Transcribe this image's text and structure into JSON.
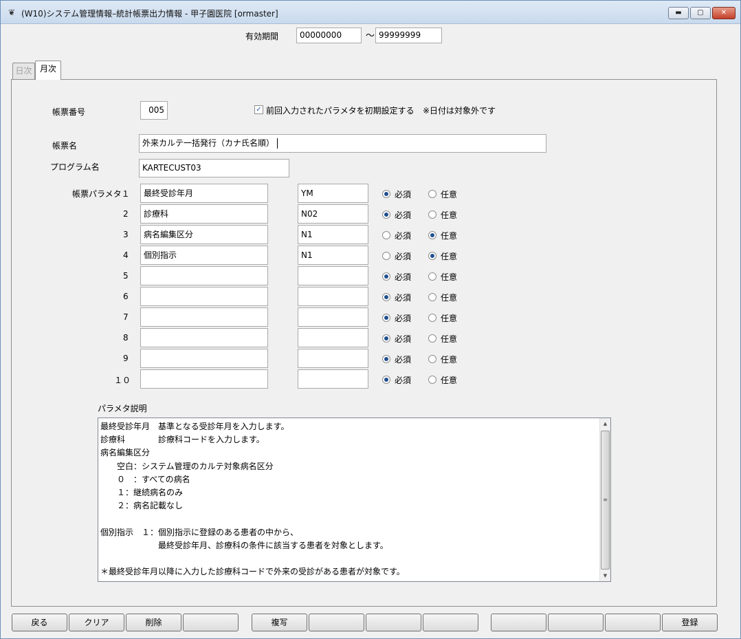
{
  "window": {
    "title": "(W10)システム管理情報–統計帳票出力情報 - 甲子園医院  [ormaster]",
    "minimize": "▬",
    "maximize": "▢",
    "close": "✕"
  },
  "period": {
    "label": "有効期間",
    "start": "00000000",
    "separator": "～",
    "end": "99999999"
  },
  "tabs": {
    "daily": "日次",
    "monthly": "月次"
  },
  "form": {
    "report_no_label": "帳票番号",
    "report_no": "005",
    "init_check_label": "前回入力されたパラメタを初期設定する",
    "init_check_note": "※日付は対象外です",
    "report_name_label": "帳票名",
    "report_name": "外来カルテ一括発行（カナ氏名順）",
    "program_label": "プログラム名",
    "program": "KARTECUST03",
    "param_label": "帳票パラメタ１",
    "required_label": "必須",
    "optional_label": "任意"
  },
  "params": [
    {
      "no": "",
      "name": "最終受診年月",
      "code": "YM",
      "required": true
    },
    {
      "no": "2",
      "name": "診療科",
      "code": "N02",
      "required": true
    },
    {
      "no": "3",
      "name": "病名編集区分",
      "code": "N1",
      "required": false
    },
    {
      "no": "4",
      "name": "個別指示",
      "code": "N1",
      "required": false
    },
    {
      "no": "5",
      "name": "",
      "code": "",
      "required": true
    },
    {
      "no": "6",
      "name": "",
      "code": "",
      "required": true
    },
    {
      "no": "7",
      "name": "",
      "code": "",
      "required": true
    },
    {
      "no": "8",
      "name": "",
      "code": "",
      "required": true
    },
    {
      "no": "9",
      "name": "",
      "code": "",
      "required": true
    },
    {
      "no": "１０",
      "name": "",
      "code": "",
      "required": true
    }
  ],
  "description": {
    "label": "パラメタ説明",
    "text": "最終受診年月　基準となる受診年月を入力します。\n診療科　　　　診療科コードを入力します。\n病名編集区分\n　　空白：システム管理のカルテ対象病名区分\n　　０　：すべての病名\n　　１：継続病名のみ\n　　２：病名記載なし\n\n個別指示　１：個別指示に登録のある患者の中から、\n　　　　　　　最終受診年月、診療科の条件に該当する患者を対象とします。\n\n＊最終受診年月以降に入力した診療科コードで外来の受診がある患者が対象です。"
  },
  "footer": {
    "back": "戻る",
    "clear": "クリア",
    "delete": "削除",
    "blank1": "",
    "copy": "複写",
    "blank2": "",
    "blank3": "",
    "blank4": "",
    "blank5": "",
    "blank6": "",
    "blank7": "",
    "register": "登録"
  }
}
